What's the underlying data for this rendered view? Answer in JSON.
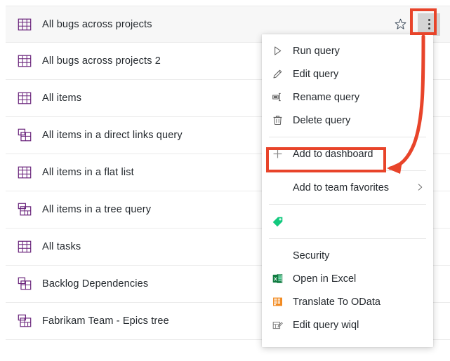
{
  "query_list": {
    "rows": [
      {
        "label": "All bugs across projects",
        "icon": "flat-query-icon",
        "selected": true,
        "has_actions": true
      },
      {
        "label": "All bugs across projects 2",
        "icon": "flat-query-icon",
        "selected": false,
        "has_actions": false
      },
      {
        "label": "All items",
        "icon": "flat-query-icon",
        "selected": false,
        "has_actions": false
      },
      {
        "label": "All items in a direct links query",
        "icon": "direct-links-query-icon",
        "selected": false,
        "has_actions": false
      },
      {
        "label": "All items in a flat list",
        "icon": "flat-query-icon",
        "selected": false,
        "has_actions": false
      },
      {
        "label": "All items in a tree query",
        "icon": "tree-query-icon",
        "selected": false,
        "has_actions": false
      },
      {
        "label": "All tasks",
        "icon": "flat-query-icon",
        "selected": false,
        "has_actions": false
      },
      {
        "label": "Backlog Dependencies",
        "icon": "direct-links-query-icon",
        "selected": false,
        "has_actions": false
      },
      {
        "label": "Fabrikam Team - Epics tree",
        "icon": "tree-query-icon",
        "selected": false,
        "has_actions": false
      }
    ],
    "row_actions": {
      "favorite_icon": "star-outline-icon",
      "more_icon": "more-vertical-ellipsis-icon"
    }
  },
  "context_menu": {
    "items": [
      {
        "label": "Run query",
        "icon": "play-triangle-icon",
        "type": "item"
      },
      {
        "label": "Edit query",
        "icon": "pencil-icon",
        "type": "item"
      },
      {
        "label": "Rename query",
        "icon": "rename-icon",
        "type": "item"
      },
      {
        "label": "Delete query",
        "icon": "trash-icon",
        "type": "item"
      },
      {
        "type": "separator"
      },
      {
        "label": "Add to dashboard",
        "icon": "plus-icon",
        "type": "item",
        "highlighted": true
      },
      {
        "type": "separator"
      },
      {
        "label": "Add to team favorites",
        "icon": "none",
        "type": "submenu",
        "chevron": "chevron-right-icon"
      },
      {
        "type": "separator"
      },
      {
        "label": "",
        "icon": "green-tag-icon",
        "type": "icon-only"
      },
      {
        "type": "separator"
      },
      {
        "label": "Security",
        "icon": "none",
        "type": "item"
      },
      {
        "label": "Open in Excel",
        "icon": "excel-icon",
        "type": "item"
      },
      {
        "label": "Translate To OData",
        "icon": "odata-icon",
        "type": "item"
      },
      {
        "label": "Edit query wiql",
        "icon": "edit-wiql-icon",
        "type": "item"
      }
    ]
  },
  "annotations": {
    "highlight_color": "#e8442a",
    "arrow_from": "more-vertical-ellipsis-icon",
    "arrow_to": "Add to dashboard"
  },
  "colors": {
    "query_icon": "#68217a",
    "excel_green": "#107c41",
    "odata_orange": "#f2891e",
    "tag_green": "#12c97e",
    "selected_row_bg": "#f7f7f7",
    "text": "#24292e"
  }
}
